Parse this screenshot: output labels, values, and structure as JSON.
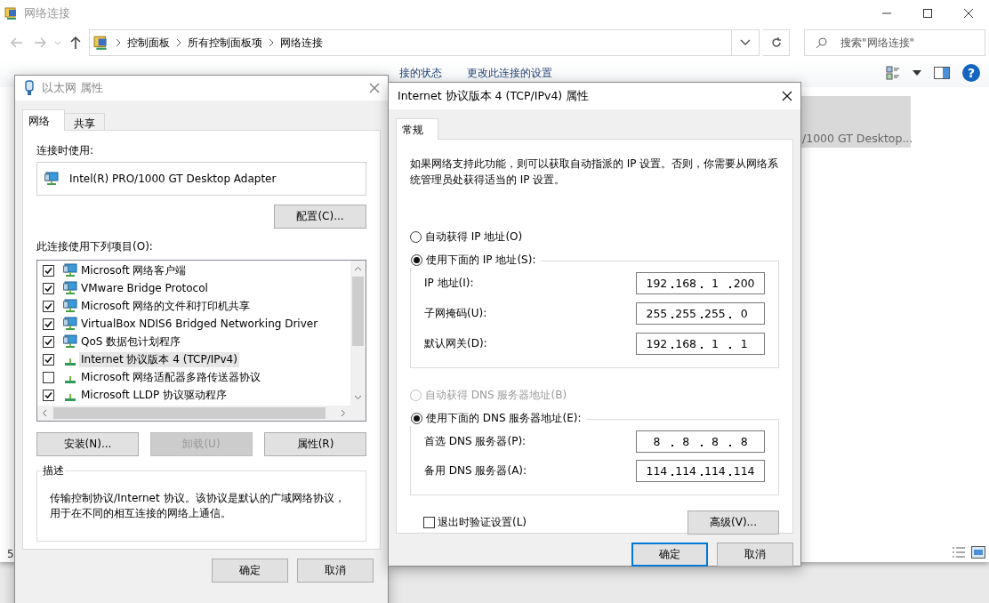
{
  "explorer": {
    "title": "网络连接",
    "breadcrumb": [
      "控制面板",
      "所有控制面板项",
      "网络连接"
    ],
    "search": {
      "placeholder": "搜索\"网络连接\""
    },
    "toolbar_links": [
      "接的状态",
      "更改此连接的设置"
    ],
    "help_icon": "?",
    "item_text": "/1000 GT Desktop...",
    "status_text": "5"
  },
  "ethernet_dialog": {
    "title": "以太网 属性",
    "tabs": [
      {
        "label": "网络",
        "selected": true
      },
      {
        "label": "共享",
        "selected": false
      }
    ],
    "connect_using_label": "连接时使用:",
    "adapter": "Intel(R) PRO/1000 GT Desktop Adapter",
    "configure_button": "配置(C)...",
    "items_label": "此连接使用下列项目(O):",
    "items": [
      {
        "kind": "service",
        "label": "Microsoft 网络客户端",
        "checked": true,
        "selected": false
      },
      {
        "kind": "service",
        "label": "VMware Bridge Protocol",
        "checked": true,
        "selected": false
      },
      {
        "kind": "service",
        "label": "Microsoft 网络的文件和打印机共享",
        "checked": true,
        "selected": false
      },
      {
        "kind": "service",
        "label": "VirtualBox NDIS6 Bridged Networking Driver",
        "checked": true,
        "selected": false
      },
      {
        "kind": "service",
        "label": "QoS 数据包计划程序",
        "checked": true,
        "selected": false
      },
      {
        "kind": "protocol",
        "label": "Internet 协议版本 4 (TCP/IPv4)",
        "checked": true,
        "selected": true
      },
      {
        "kind": "protocol",
        "label": "Microsoft 网络适配器多路传送器协议",
        "checked": false,
        "selected": false
      },
      {
        "kind": "protocol",
        "label": "Microsoft LLDP 协议驱动程序",
        "checked": true,
        "selected": false
      }
    ],
    "buttons": [
      {
        "label": "安装(N)...",
        "disabled": false
      },
      {
        "label": "卸载(U)",
        "disabled": true
      },
      {
        "label": "属性(R)",
        "disabled": false
      }
    ],
    "description_title": "描述",
    "description": "传输控制协议/Internet 协议。该协议是默认的广域网络协议，用于在不同的相互连接的网络上通信。",
    "ok_button": "确定",
    "cancel_button": "取消"
  },
  "ipv4_dialog": {
    "title": "Internet 协议版本 4 (TCP/IPv4) 属性",
    "tabs": [
      {
        "label": "常规",
        "selected": true
      }
    ],
    "intro": "如果网络支持此功能，则可以获取自动指派的 IP 设置。否则，你需要从网络系统管理员处获得适当的 IP 设置。",
    "ip_modes": [
      {
        "label": "自动获得 IP 地址(O)",
        "selected": false,
        "disabled": false
      },
      {
        "label": "使用下面的 IP 地址(S):",
        "selected": true,
        "disabled": false
      }
    ],
    "ip_fields": [
      {
        "label": "IP 地址(I):",
        "value": [
          "192",
          "168",
          "1",
          "200"
        ]
      },
      {
        "label": "子网掩码(U):",
        "value": [
          "255",
          "255",
          "255",
          "0"
        ]
      },
      {
        "label": "默认网关(D):",
        "value": [
          "192",
          "168",
          "1",
          "1"
        ]
      }
    ],
    "dns_modes": [
      {
        "label": "自动获得 DNS 服务器地址(B)",
        "selected": false,
        "disabled": true
      },
      {
        "label": "使用下面的 DNS 服务器地址(E):",
        "selected": true,
        "disabled": false
      }
    ],
    "dns_fields": [
      {
        "label": "首选 DNS 服务器(P):",
        "value": [
          "8",
          "8",
          "8",
          "8"
        ]
      },
      {
        "label": "备用 DNS 服务器(A):",
        "value": [
          "114",
          "114",
          "114",
          "114"
        ]
      }
    ],
    "validate_checkbox": {
      "label": "退出时验证设置(L)",
      "checked": false
    },
    "advanced_button": "高级(V)...",
    "ok_button": "确定",
    "cancel_button": "取消"
  }
}
